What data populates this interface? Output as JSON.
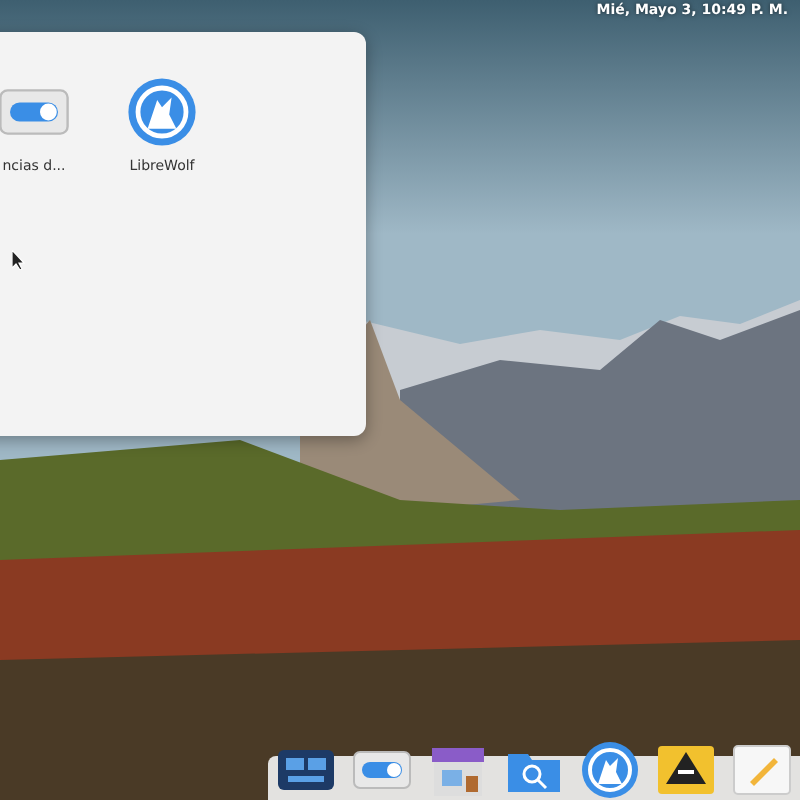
{
  "top_bar": {
    "clock": "Mié, Mayo 3, 10:49 P. M."
  },
  "window": {
    "apps": [
      {
        "kind": "toggle",
        "label": "ncias d..."
      },
      {
        "kind": "wolf",
        "label": "LibreWolf"
      }
    ]
  },
  "dock": {
    "items": [
      {
        "kind": "multitasking"
      },
      {
        "kind": "toggle"
      },
      {
        "kind": "store"
      },
      {
        "kind": "files"
      },
      {
        "kind": "wolf"
      },
      {
        "kind": "vector"
      },
      {
        "kind": "notes"
      }
    ]
  }
}
